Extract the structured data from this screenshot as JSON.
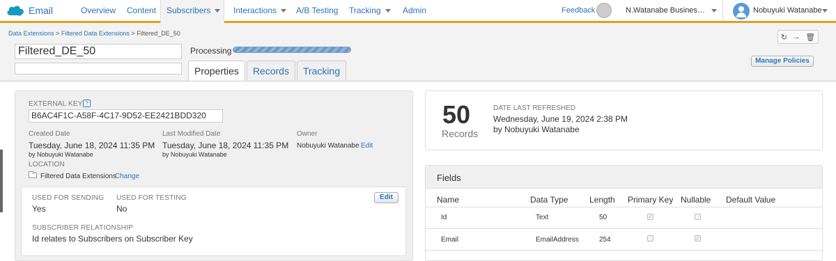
{
  "app": {
    "name": "Email"
  },
  "nav": {
    "items": [
      {
        "label": "Overview"
      },
      {
        "label": "Content"
      },
      {
        "label": "Subscribers"
      },
      {
        "label": "Interactions"
      },
      {
        "label": "A/B Testing"
      },
      {
        "label": "Tracking"
      },
      {
        "label": "Admin"
      }
    ],
    "active": "Subscribers",
    "feedback": "Feedback",
    "org": "N.Watanabe Business ...",
    "user": "Nobuyuki Watanabe"
  },
  "breadcrumb": {
    "items": [
      "Data Extensions",
      "Filtered Data Extensions",
      "Filtered_DE_50"
    ],
    "separator": ">"
  },
  "header": {
    "name_value": "Filtered_DE_50",
    "description_value": "",
    "status": "Processing",
    "progress_fraction": 1.0,
    "manage_policies": "Manage Policies"
  },
  "tabs": [
    {
      "label": "Properties",
      "active": true
    },
    {
      "label": "Records",
      "active": false
    },
    {
      "label": "Tracking",
      "active": false
    }
  ],
  "properties": {
    "external_key_label": "EXTERNAL KEY",
    "help_glyph": "?",
    "external_key": "B6AC4F1C-A58F-4C17-9D52-EE2421BDD320",
    "created_label": "Created Date",
    "created_date": "Tuesday, June 18, 2024 11:35 PM",
    "created_by": "by Nobuyuki Watanabe",
    "modified_label": "Last Modified Date",
    "modified_date": "Tuesday, June 18, 2024 11:35 PM",
    "modified_by": "by Nobuyuki Watanabe",
    "owner_label": "Owner",
    "owner": "Nobuyuki Watanabe",
    "owner_edit": "Edit",
    "location_label": "LOCATION",
    "location": "Filtered Data Extensions",
    "location_change": "Change"
  },
  "settings": {
    "edit": "Edit",
    "used_for_sending_label": "USED FOR SENDING",
    "used_for_sending": "Yes",
    "used_for_testing_label": "USED FOR TESTING",
    "used_for_testing": "No",
    "relationship_label": "SUBSCRIBER RELATIONSHIP",
    "relationship": "Id relates to Subscribers on Subscriber Key"
  },
  "stats": {
    "count": "50",
    "records_label": "Records",
    "refreshed_label": "DATE LAST REFRESHED",
    "refreshed_date": "Wednesday, June 19, 2024 2:38 PM",
    "refreshed_by": "by Nobuyuki Watanabe"
  },
  "fields": {
    "title": "Fields",
    "columns": [
      "Name",
      "Data Type",
      "Length",
      "Primary Key",
      "Nullable",
      "Default Value"
    ],
    "rows": [
      {
        "name": "Id",
        "type": "Text",
        "length": "50",
        "primary_key": true,
        "nullable": false,
        "default": ""
      },
      {
        "name": "Email",
        "type": "EmailAddress",
        "length": "254",
        "primary_key": false,
        "nullable": true,
        "default": ""
      }
    ]
  },
  "colors": {
    "accent": "#e0a020",
    "link": "#2a74b8"
  }
}
